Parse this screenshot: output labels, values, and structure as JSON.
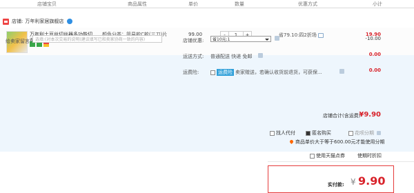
{
  "header": {
    "col_item": "店铺宝贝",
    "col_attr": "商品属性",
    "col_price": "单价",
    "col_qty": "数量",
    "col_promo": "优惠方式",
    "col_subtotal": "小计"
  },
  "shop": {
    "label": "店铺:",
    "name": "万年利家居旗舰店"
  },
  "item": {
    "title": "万年利土豆丝切丝器多功能切菜...",
    "attr": "颜色分类：简易款C款(三刀)片无护手器)",
    "price": "99.00",
    "qty_minus": "-",
    "qty": "1",
    "qty_plus": "+",
    "promo": "省79.10:四2折场",
    "subtotal": "19.90"
  },
  "message": {
    "label": "给卖家留言：",
    "placeholder": "选填:(对本次交易的说明(建议填写已和卖家协商一致的内容)"
  },
  "store_discount": {
    "label": "店铺优惠:",
    "selected": "省10元:1",
    "amount": "-10.00"
  },
  "shipping": {
    "label": "运送方式:",
    "text": "普通配送 快递 免邮",
    "amount": "0.00"
  },
  "insurance": {
    "label": "运费险:",
    "badge": "运费险",
    "text": "卖家赠送，若确认收货前退货，可获保...",
    "amount": "0.00"
  },
  "store_total": {
    "label": "店铺合计(含运费)",
    "value": "¥9.90"
  },
  "options": {
    "friend_pay": "找人代付",
    "anonymous": "匿名购买",
    "installment": "花呗分期"
  },
  "installment_note": "商品单价大于等于600.00元才能使用分期",
  "tmall": {
    "label": "使用天猫点券",
    "date": "使期时折扣"
  },
  "payment": {
    "label": "实付款:",
    "currency": "¥",
    "value": "9.90"
  }
}
